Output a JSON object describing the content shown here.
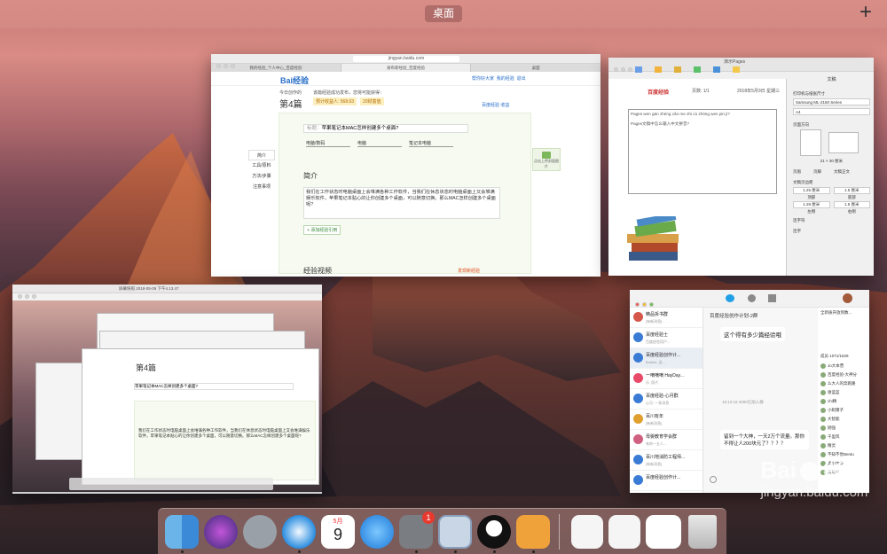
{
  "mission_control": {
    "space_label": "桌面",
    "add_space": "+"
  },
  "safari_window": {
    "url": "jingyan.baidu.com",
    "tabs": [
      "我的经验_个人中心_百度经验",
      "发布新经验_百度经验",
      "桌面"
    ],
    "nav_links": [
      "帮你好大家",
      "我的经验",
      "退出"
    ],
    "logo": "Bai经验",
    "today_label": "今日创作的",
    "article_count": "第4篇",
    "success_msg": "该篇经验成功发布，您将可能获得：",
    "reward1": "预计收益人: 568.63",
    "reward2": "20财富值",
    "pay_note": "百度经验 收益",
    "title_label": "标题：",
    "title_value": "苹果笔记本MAC怎样创建多个桌面?",
    "categories": [
      "电脑/数码",
      "电脑",
      "笔记本电脑"
    ],
    "side_tabs": [
      "简介",
      "工具/原料",
      "方法/步骤",
      "注意事项"
    ],
    "intro_heading": "简介",
    "intro_text": "我们在工作状态时电脑桌面上会堆满各种工作软件，当我们在休息状态时电脑桌面上又会堆满娱乐软件，苹果笔记本贴心的让你创建多个桌面，可以随意切换。那么MAC怎样创建多个桌面呢?",
    "add_ref": "+ 添加经验引用",
    "video_heading": "经验视频",
    "upload_cover": "点击上传封面图片",
    "ad_link": "发现新经验"
  },
  "pages_window": {
    "title": "演示Pages",
    "doc_title": "百度经验",
    "page_label": "页数: 1/1",
    "date": "2018年5月9日 星期三",
    "line1": "Pages wen gān zhéng cǎn me zhi cù zhōng wen pin ji?",
    "line2": "Pages文稿中怎么输入中文拼音?",
    "panel_title": "文稿",
    "printer_label": "打印机与纸张尺寸",
    "printer": "Samsung ML-2160 Series",
    "paper": "A4",
    "orientation": "页面方向",
    "size": "21 × 30 厘米",
    "options": [
      "页眉",
      "页脚",
      "文稿正文"
    ],
    "margins_label": "文稿页边距",
    "margins": [
      "1.25 厘米",
      "1.5 厘米",
      "1.28 厘米",
      "1.5 厘米"
    ],
    "margin_names": [
      "顶部",
      "底部",
      "左侧",
      "右侧"
    ],
    "hyphen": "连字符",
    "ligature": "连字"
  },
  "desktop_preview": {
    "title": "屏幕快照 2018-05-09 下午4.13.47"
  },
  "qq_window": {
    "contacts": [
      {
        "name": "精品拆书群",
        "msg": "[有新消息]..."
      },
      {
        "name": "百度经验士",
        "msg": "百度经验用户..."
      },
      {
        "name": "百度经验创作计...",
        "msg": "Bubble: 这..."
      },
      {
        "name": "一嘀嘀嘀 HayDay...",
        "msg": "乐: 照片"
      },
      {
        "name": "百度经验-心月群",
        "msg": "心月: 一条消息"
      },
      {
        "name": "百川有年",
        "msg": "[有新消息]"
      },
      {
        "name": "母婴教育学会群",
        "msg": "有你一五人..."
      },
      {
        "name": "百川地消防工程师...",
        "msg": "[有新消息]"
      },
      {
        "name": "百度经验创作计...",
        "msg": "..."
      }
    ],
    "chat_title": "百度经验创作计划-2群",
    "chat_msg1": "这个得有多少篇经验哦",
    "chat_time": "16:12:18 2090已加入群",
    "chat_msg2": "留到一个大神，一天2万个流量。那你不得让人200块元了？？？？",
    "member_panel": "全新质开放到数...",
    "member_count": "成员 1071/1629",
    "members": [
      "Jo大本营",
      "百度经验-大神分",
      "么大人的奔跑路",
      "谢蓝蓝",
      "chi精",
      "小刺猬子",
      "大智能",
      "刚强",
      "千里风",
      "精灵",
      "不知不觉Bentu",
      "奥小尔多",
      "高可平"
    ]
  },
  "dock": {
    "calendar_month": "5月",
    "calendar_day": "9",
    "prefs_badge": "1"
  },
  "watermark": {
    "logo": "Bai",
    "text": "经验",
    "url": "jingyan.baidu.com"
  }
}
